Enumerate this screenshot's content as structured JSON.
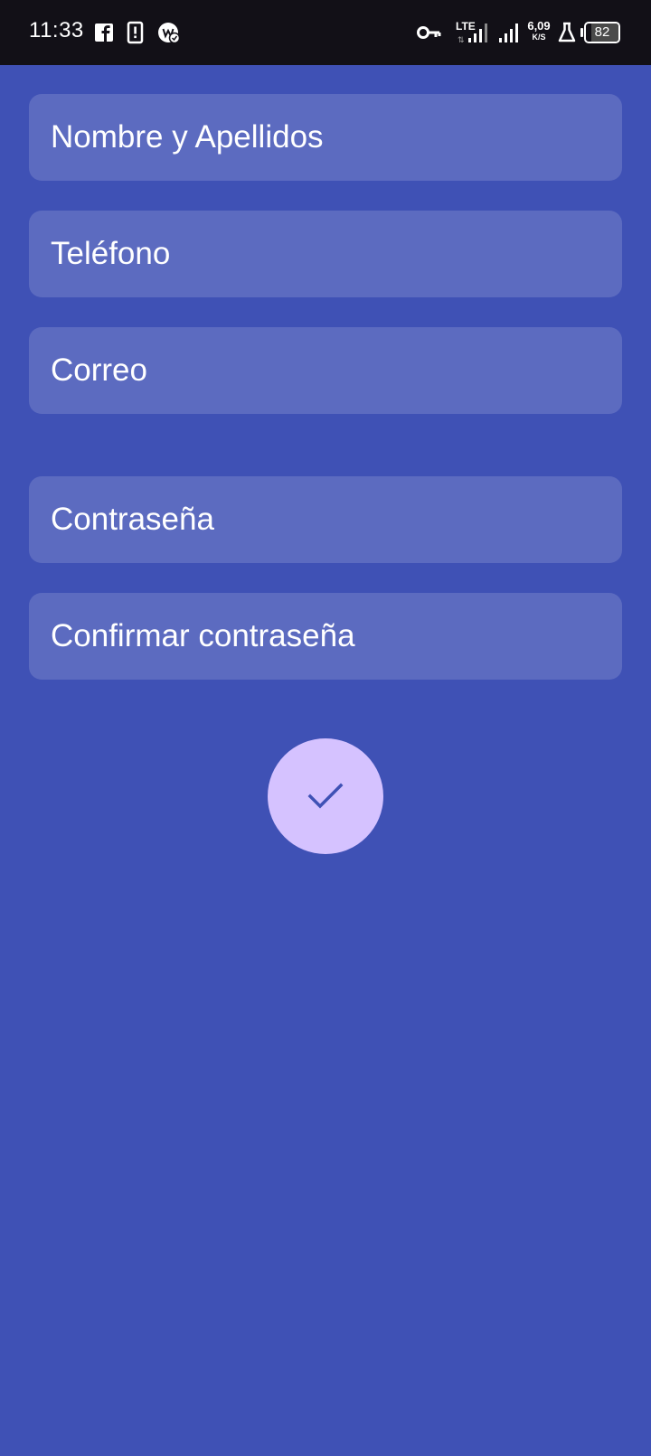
{
  "status_bar": {
    "time": "11:33",
    "network_type": "LTE",
    "speed_value": "6,09",
    "speed_unit": "K/S",
    "battery": "82",
    "left_icons": [
      "facebook-icon",
      "alert-icon",
      "app-badge-icon"
    ],
    "right_icons": [
      "vpn-key-icon",
      "lte-signal-icon",
      "signal-icon",
      "lab-flask-icon",
      "battery-icon"
    ]
  },
  "form": {
    "name_placeholder": "Nombre y Apellidos",
    "phone_placeholder": "Teléfono",
    "email_placeholder": "Correo",
    "password_placeholder": "Contraseña",
    "confirm_password_placeholder": "Confirmar contraseña",
    "submit_icon": "check-icon"
  },
  "colors": {
    "background": "#3f51b5",
    "field_background": "#5c6bc0",
    "fab_background": "#d5c2ff",
    "check_color": "#3f51b5",
    "status_bar": "#121017"
  }
}
